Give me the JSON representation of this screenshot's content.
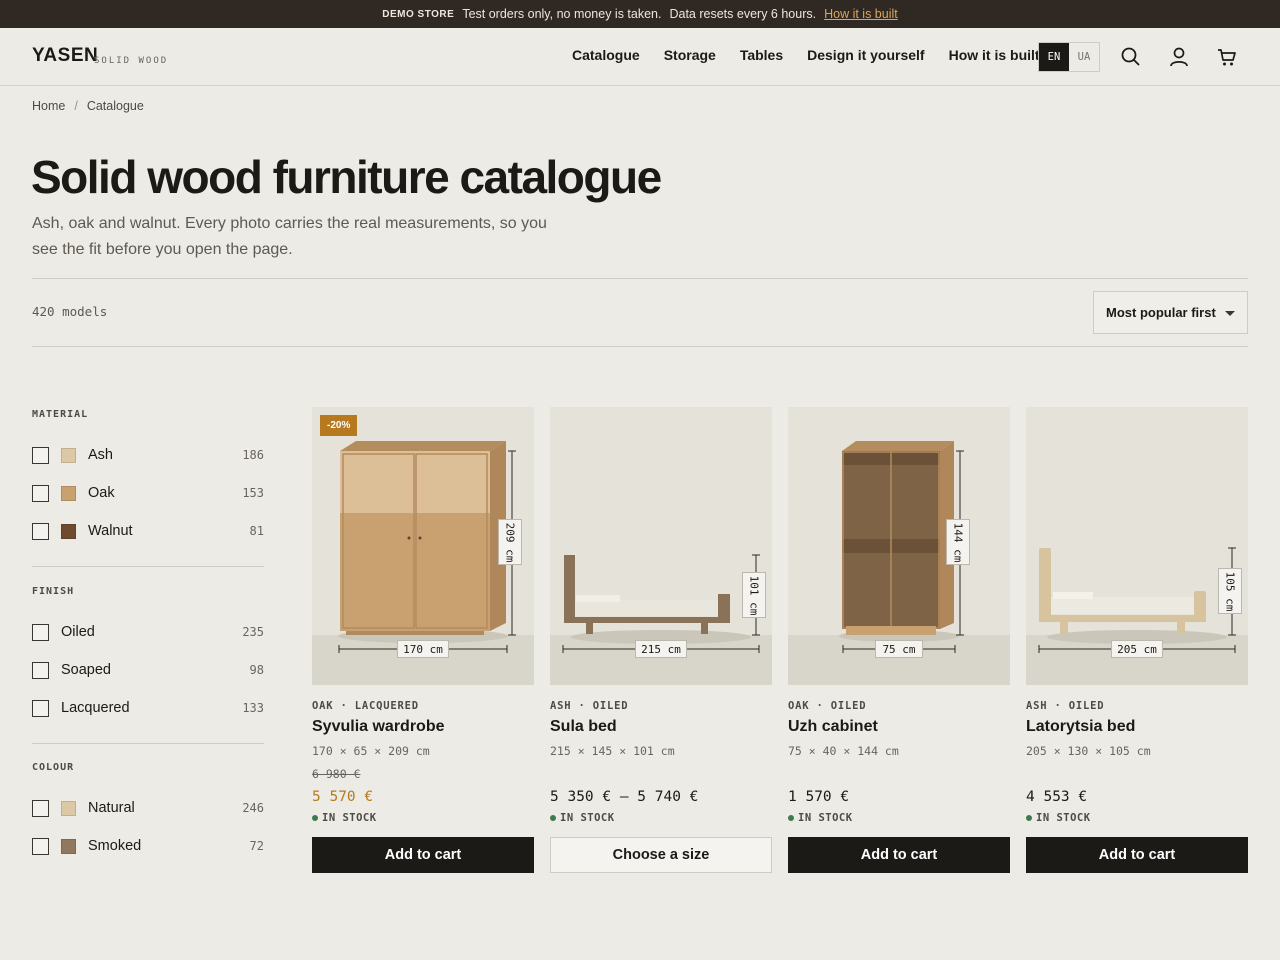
{
  "demo": {
    "tag": "DEMO STORE",
    "text": "Test orders only, no money is taken.",
    "text2": "Data resets every 6 hours.",
    "link": "How it is built"
  },
  "header": {
    "logo": "YASEN",
    "logo_sub": "SOLID WOOD",
    "nav": [
      "Catalogue",
      "Storage",
      "Tables",
      "Design it yourself",
      "How it is built"
    ],
    "lang_active": "EN",
    "lang_other": "UA"
  },
  "breadcrumb": {
    "home": "Home",
    "sep": "/",
    "current": "Catalogue"
  },
  "page": {
    "title": "Solid wood furniture catalogue",
    "subtitle": "Ash, oak and walnut. Every photo carries the real measurements, so you see the fit before you open the page.",
    "count": "420 models",
    "sort": "Most popular first"
  },
  "filters": {
    "material": {
      "heading": "MATERIAL",
      "items": [
        {
          "label": "Ash",
          "count": "186",
          "color": "#dcc8a4"
        },
        {
          "label": "Oak",
          "count": "153",
          "color": "#c9a070"
        },
        {
          "label": "Walnut",
          "count": "81",
          "color": "#6f4a2e"
        }
      ]
    },
    "finish": {
      "heading": "FINISH",
      "items": [
        {
          "label": "Oiled",
          "count": "235"
        },
        {
          "label": "Soaped",
          "count": "98"
        },
        {
          "label": "Lacquered",
          "count": "133"
        }
      ]
    },
    "colour": {
      "heading": "COLOUR",
      "items": [
        {
          "label": "Natural",
          "count": "246",
          "color": "#dcc8a4"
        },
        {
          "label": "Smoked",
          "count": "72",
          "color": "#8f7760"
        }
      ]
    }
  },
  "products": [
    {
      "badge": "-20%",
      "meta": "OAK · LACQUERED",
      "name": "Syvulia wardrobe",
      "dims": "170 × 65 × 209 cm",
      "old_price": "6 980 €",
      "price": "5 570 €",
      "stock": "IN STOCK",
      "button": "Add to cart",
      "width_label": "170 cm",
      "height_label": "209 cm"
    },
    {
      "meta": "ASH · OILED",
      "name": "Sula bed",
      "dims": "215 × 145 × 101 cm",
      "price": "5 350 € – 5 740 €",
      "stock": "IN STOCK",
      "button": "Choose a size",
      "width_label": "215 cm",
      "height_label": "101 cm"
    },
    {
      "meta": "OAK · OILED",
      "name": "Uzh cabinet",
      "dims": "75 × 40 × 144 cm",
      "price": "1 570 €",
      "stock": "IN STOCK",
      "button": "Add to cart",
      "width_label": "75 cm",
      "height_label": "144 cm"
    },
    {
      "meta": "ASH · OILED",
      "name": "Latorytsia bed",
      "dims": "205 × 130 × 105 cm",
      "price": "4 553 €",
      "stock": "IN STOCK",
      "button": "Add to cart",
      "width_label": "205 cm",
      "height_label": "105 cm"
    }
  ],
  "colors": {
    "accent": "#b7791f",
    "dark": "#1c1a17",
    "demo_bar": "#302822",
    "link": "#d9a65a",
    "stock_dot": "#3f7a4a"
  },
  "icons": [
    "search-icon",
    "user-icon",
    "cart-icon"
  ]
}
